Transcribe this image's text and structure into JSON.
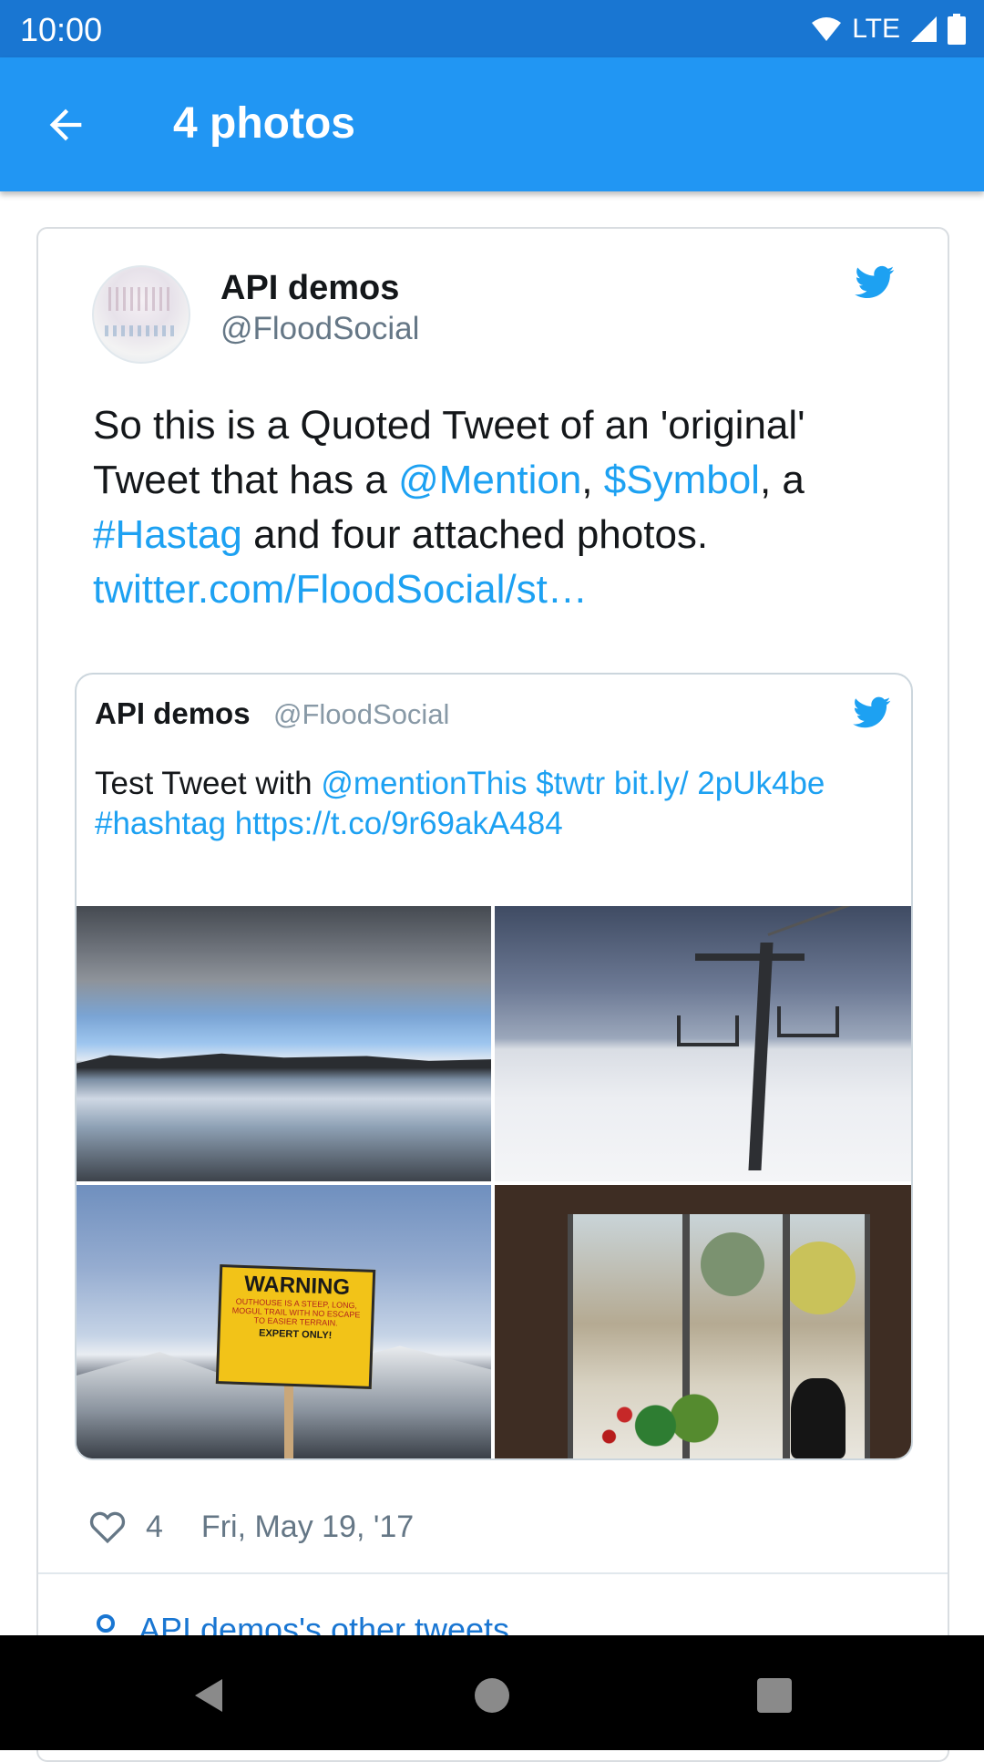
{
  "status_bar": {
    "time": "10:00",
    "network": "LTE"
  },
  "app_bar": {
    "title": "4 photos"
  },
  "tweet": {
    "author_name": "API demos",
    "author_handle": "@FloodSocial",
    "text": {
      "part1": "So this is a Quoted Tweet of an 'original' Tweet that has a ",
      "mention": "@Mention",
      "part2": ",  ",
      "symbol": "$Symbol",
      "part3": ", a ",
      "hashtag": "#Hastag",
      "part4": " and four attached photos. ",
      "url": "twitter.com/FloodSocial/st…"
    },
    "quoted": {
      "author_name": "API demos",
      "author_handle": "@FloodSocial",
      "text": {
        "part1": "Test Tweet with ",
        "mention": "@mentionThis",
        "symbol": "$twtr",
        "link": "bit.ly/ 2pUk4be",
        "hashtag": "#hashtag",
        "url": "https://t.co/9r69akA484"
      },
      "photos": [
        {
          "alt": "Cloudy sky over a lake"
        },
        {
          "alt": "Ski lift over snow"
        },
        {
          "alt": "Warning sign on mountain"
        },
        {
          "alt": "Cat by a window"
        }
      ],
      "sign": {
        "title": "WARNING",
        "line1": "OUTHOUSE IS A STEEP, LONG,",
        "line2": "MOGUL TRAIL WITH NO ESCAPE",
        "line3": "TO EASIER TERRAIN.",
        "expert": "EXPERT ONLY!"
      }
    },
    "like_count": "4",
    "date": "Fri, May 19, '17",
    "other_tweets_label": "API demos's other tweets"
  },
  "colors": {
    "app_bar": "#2196f3",
    "status_bar": "#1976d2",
    "twitter_blue": "#1da1f2",
    "secondary_text": "#657786"
  },
  "icons": [
    "back-arrow-icon",
    "wifi-icon",
    "signal-icon",
    "battery-icon",
    "twitter-bird-icon",
    "heart-icon",
    "location-pin-icon",
    "nav-back-icon",
    "nav-home-icon",
    "nav-recent-icon"
  ]
}
